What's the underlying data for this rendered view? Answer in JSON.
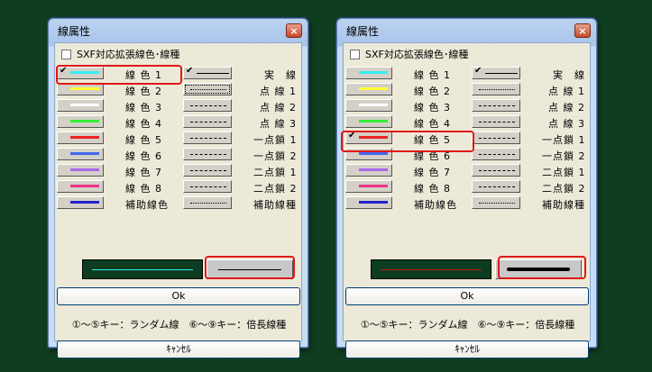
{
  "dialog1": {
    "title": "線属性",
    "close": "×",
    "checkbox_label": "SXF対応拡張線色･線種",
    "colors": [
      {
        "label": "線 色 1",
        "color": "#33eeee",
        "checked": true
      },
      {
        "label": "線 色 2",
        "color": "#ffff33",
        "checked": false
      },
      {
        "label": "線 色 3",
        "color": "#ffffff",
        "checked": false
      },
      {
        "label": "線 色 4",
        "color": "#33ee33",
        "checked": false
      },
      {
        "label": "線 色 5",
        "color": "#ee2222",
        "checked": false
      },
      {
        "label": "線 色 6",
        "color": "#4466ee",
        "checked": false
      },
      {
        "label": "線 色 7",
        "color": "#aa66ee",
        "checked": false
      },
      {
        "label": "線 色 8",
        "color": "#ee3388",
        "checked": false
      },
      {
        "label": "補助線色",
        "color": "#2222cc",
        "checked": false
      }
    ],
    "types": [
      {
        "label": "実　線",
        "style": "solid",
        "checked": true
      },
      {
        "label": "点 線 1",
        "style": "dotted",
        "checked": false
      },
      {
        "label": "点 線 2",
        "style": "dashed",
        "checked": false
      },
      {
        "label": "点 線 3",
        "style": "dashed",
        "checked": false
      },
      {
        "label": "一点鎖 1",
        "style": "dashdot",
        "checked": false
      },
      {
        "label": "一点鎖 2",
        "style": "dashdot",
        "checked": false
      },
      {
        "label": "二点鎖 1",
        "style": "dashdot",
        "checked": false
      },
      {
        "label": "二点鎖 2",
        "style": "dashdot",
        "checked": false
      },
      {
        "label": "補助線種",
        "style": "dotted",
        "checked": false
      }
    ],
    "preview_color": "#33eeee",
    "ok_label": "Ok",
    "hint": "①～⑤キー：ランダム線　⑥～⑨キー：倍長線種",
    "cancel_label": "ｷｬﾝｾﾙ"
  },
  "dialog2": {
    "title": "線属性",
    "close": "×",
    "checkbox_label": "SXF対応拡張線色･線種",
    "colors": [
      {
        "label": "線 色 1",
        "color": "#33eeee",
        "checked": false
      },
      {
        "label": "線 色 2",
        "color": "#ffff33",
        "checked": false
      },
      {
        "label": "線 色 3",
        "color": "#ffffff",
        "checked": false
      },
      {
        "label": "線 色 4",
        "color": "#33ee33",
        "checked": false
      },
      {
        "label": "線 色 5",
        "color": "#ee2222",
        "checked": true
      },
      {
        "label": "線 色 6",
        "color": "#4466ee",
        "checked": false
      },
      {
        "label": "線 色 7",
        "color": "#aa66ee",
        "checked": false
      },
      {
        "label": "線 色 8",
        "color": "#ee3388",
        "checked": false
      },
      {
        "label": "補助線色",
        "color": "#2222cc",
        "checked": false
      }
    ],
    "types": [
      {
        "label": "実　線",
        "style": "solid",
        "checked": true
      },
      {
        "label": "点 線 1",
        "style": "dotted",
        "checked": false
      },
      {
        "label": "点 線 2",
        "style": "dashed",
        "checked": false
      },
      {
        "label": "点 線 3",
        "style": "dashed",
        "checked": false
      },
      {
        "label": "一点鎖 1",
        "style": "dashdot",
        "checked": false
      },
      {
        "label": "一点鎖 2",
        "style": "dashdot",
        "checked": false
      },
      {
        "label": "二点鎖 1",
        "style": "dashdot",
        "checked": false
      },
      {
        "label": "二点鎖 2",
        "style": "dashdot",
        "checked": false
      },
      {
        "label": "補助線種",
        "style": "dotted",
        "checked": false
      }
    ],
    "preview_color": "#cc1111",
    "ok_label": "Ok",
    "hint": "①～⑤キー：ランダム線　⑥～⑨キー：倍長線種",
    "cancel_label": "ｷｬﾝｾﾙ"
  }
}
